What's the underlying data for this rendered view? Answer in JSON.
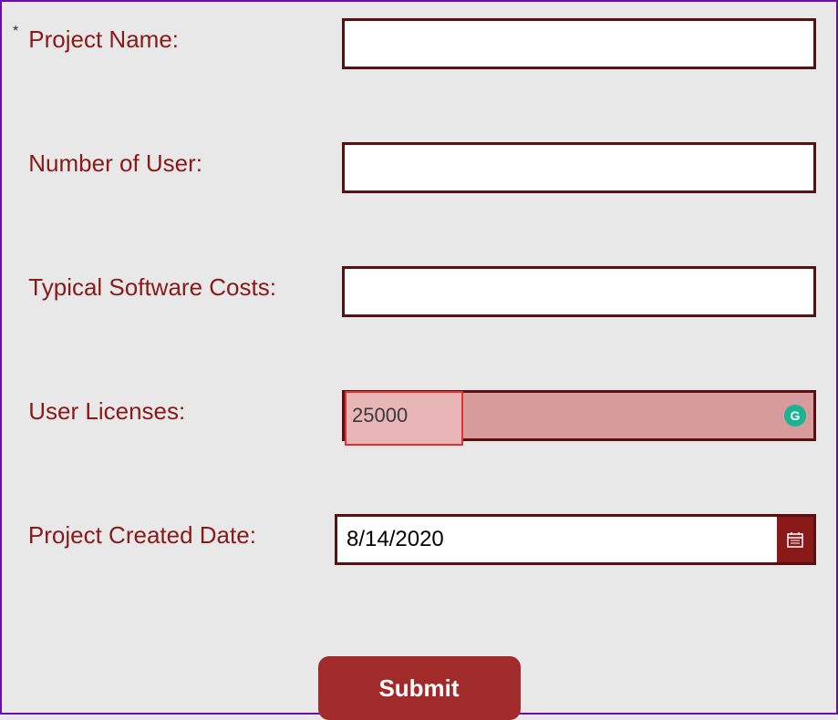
{
  "form": {
    "required_mark": "*",
    "project_name": {
      "label": "Project Name:",
      "value": ""
    },
    "number_of_user": {
      "label": "Number of User:",
      "value": ""
    },
    "typical_software_costs": {
      "label": "Typical Software Costs:",
      "value": ""
    },
    "user_licenses": {
      "label": "User Licenses:",
      "value": "25000",
      "grammarly_glyph": "G"
    },
    "project_created_date": {
      "label": "Project Created Date:",
      "value": "8/14/2020"
    },
    "submit_label": "Submit"
  }
}
